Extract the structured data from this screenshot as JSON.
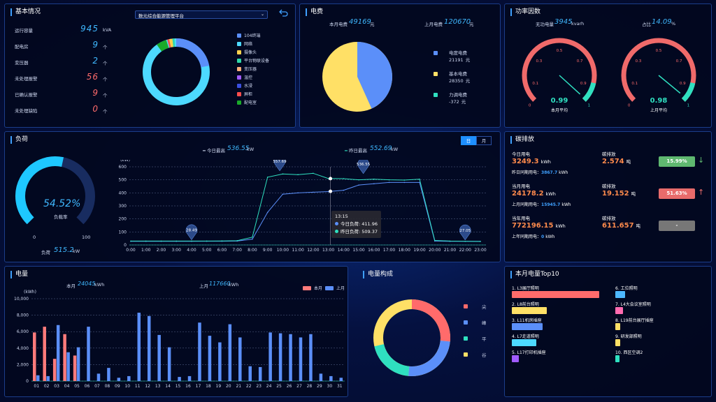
{
  "basic": {
    "title": "基本情况",
    "selector": "数元综合能源管理平台",
    "rows": [
      {
        "label": "运行容量",
        "value": "945",
        "unit": "kVA",
        "color": "#3fb8ff"
      },
      {
        "label": "配电房",
        "value": "9",
        "unit": "个",
        "color": "#3fb8ff"
      },
      {
        "label": "变压器",
        "value": "2",
        "unit": "个",
        "color": "#3fb8ff"
      },
      {
        "label": "未处理报警",
        "value": "56",
        "unit": "个",
        "color": "#ff6b6b"
      },
      {
        "label": "已确认报警",
        "value": "9",
        "unit": "个",
        "color": "#ff6b6b"
      },
      {
        "label": "未处理缺陷",
        "value": "0",
        "unit": "个",
        "color": "#ff6b6b"
      }
    ],
    "legend": [
      {
        "name": "104终端",
        "color": "#5b8ff9"
      },
      {
        "name": "网络",
        "color": "#4dd9ff"
      },
      {
        "name": "摄像头",
        "color": "#ffd24d"
      },
      {
        "name": "平台物联设备",
        "color": "#2fd8a8"
      },
      {
        "name": "变压器",
        "color": "#ffb07a"
      },
      {
        "name": "温控",
        "color": "#a05bff"
      },
      {
        "name": "水浸",
        "color": "#3a50e0"
      },
      {
        "name": "屏柜",
        "color": "#ff4d4d"
      },
      {
        "name": "配电室",
        "color": "#1aaa2a"
      }
    ]
  },
  "fee": {
    "title": "电费",
    "this_label": "本月电费",
    "this_value": "49169",
    "this_unit": "元",
    "last_label": "上月电费",
    "last_value": "120670",
    "last_unit": "元",
    "items": [
      {
        "name": "电度电费",
        "value": "21191",
        "unit": "元",
        "color": "#5b8ff9"
      },
      {
        "name": "基本电费",
        "value": "28350",
        "unit": "元",
        "color": "#ffe066"
      },
      {
        "name": "力调电费",
        "value": "-372",
        "unit": "元",
        "color": "#2fe0c0"
      }
    ]
  },
  "pf": {
    "title": "功率因数",
    "reactive_label": "无功电量",
    "reactive_value": "3945",
    "reactive_unit": "kvarh",
    "ratio_label": "占比",
    "ratio_value": "14.09",
    "ratio_unit": "%",
    "gauges": [
      {
        "value": "0.99",
        "label": "本月平均",
        "level": 0.99
      },
      {
        "value": "0.98",
        "label": "上月平均",
        "level": 0.98
      }
    ],
    "ticks": [
      "0",
      "0.1",
      "0.3",
      "0.5",
      "0.7",
      "0.9",
      "1"
    ]
  },
  "load": {
    "title": "负荷",
    "tabs": [
      "日",
      "月"
    ],
    "today_label": "今日最高",
    "today_value": "536.55",
    "today_unit": "kW",
    "yest_label": "昨日最高",
    "yest_value": "552.69",
    "yest_unit": "kW",
    "gauge_value": "54.52%",
    "gauge_label": "负载率",
    "gauge_min": "0",
    "gauge_max": "100",
    "gauge_level": 0.5452,
    "bottom_label": "负荷",
    "bottom_value": "515.2",
    "bottom_unit": "kW",
    "tip_time": "13:15",
    "tip_today": "今日负荷: 411.96",
    "tip_yest": "昨日负荷: 509.37",
    "pins": [
      {
        "label": "28.49"
      },
      {
        "label": "557.69"
      },
      {
        "label": "536.55"
      },
      {
        "label": "27.05"
      }
    ]
  },
  "carbon": {
    "title": "碳排放",
    "rows": [
      {
        "l1": "今日用电",
        "v1": "3249.3",
        "u1": "kWh",
        "sub_label": "昨日同期用电：",
        "sub_value": "3867.7",
        "sub_unit": "kWh",
        "l2": "碳排放",
        "v2": "2.574",
        "u2": "吨",
        "badge": "15.99%",
        "badge_color": "#5fb870",
        "arrow": "↓",
        "arrow_color": "#5fb870"
      },
      {
        "l1": "当月用电",
        "v1": "24178.2",
        "u1": "kWh",
        "sub_label": "上月同期用电：",
        "sub_value": "15945.7",
        "sub_unit": "kWh",
        "l2": "碳排放",
        "v2": "19.152",
        "u2": "吨",
        "badge": "51.63%",
        "badge_color": "#e86b6b",
        "arrow": "↑",
        "arrow_color": "#e86b6b"
      },
      {
        "l1": "当年用电",
        "v1": "772196.15",
        "u1": "kWh",
        "sub_label": "上年同期用电：",
        "sub_value": "0",
        "sub_unit": "kWh",
        "l2": "碳排放",
        "v2": "611.657",
        "u2": "吨",
        "badge": "-",
        "badge_color": "#777",
        "arrow": "",
        "arrow_color": "#777"
      }
    ]
  },
  "energy": {
    "title": "电量",
    "this_label": "本月",
    "this_value": "24045",
    "this_unit": "kWh",
    "last_label": "上月",
    "last_value": "117660",
    "last_unit": "kWh",
    "legend_this": "本月",
    "legend_last": "上月"
  },
  "comp": {
    "title": "电量构成",
    "items": [
      {
        "name": "尖",
        "color": "#ff6b6b"
      },
      {
        "name": "峰",
        "color": "#5b8ff9"
      },
      {
        "name": "平",
        "color": "#2fe0c0"
      },
      {
        "name": "谷",
        "color": "#ffe066"
      }
    ]
  },
  "top10": {
    "title": "本月电量Top10",
    "left": [
      {
        "name": "1. L3展厅照明",
        "color": "#ff6b6b",
        "level": 1.0
      },
      {
        "name": "2. L8前台照明",
        "color": "#ffe066",
        "level": 0.4
      },
      {
        "name": "3. L11机房插座",
        "color": "#5b8ff9",
        "level": 0.35
      },
      {
        "name": "4. L7走道照明",
        "color": "#4dd9ff",
        "level": 0.28
      },
      {
        "name": "5. L17打印机插座",
        "color": "#a05bff",
        "level": 0.08
      }
    ],
    "right": [
      {
        "name": "6. 工位照明",
        "color": "#4db8ff",
        "level": 0.12
      },
      {
        "name": "7. L4大会议室照明",
        "color": "#ff6bb0",
        "level": 0.09
      },
      {
        "name": "8. L19前台展厅插座",
        "color": "#ffe066",
        "level": 0.06
      },
      {
        "name": "9. 研发部照明",
        "color": "#ffe066",
        "level": 0.06
      },
      {
        "name": "10. 西区空调2",
        "color": "#2fe0c0",
        "level": 0.05
      }
    ]
  },
  "chart_data": [
    {
      "type": "line",
      "title": "负荷",
      "ylabel": "(kW)",
      "ylim": [
        0,
        600
      ],
      "yticks": [
        "0",
        "100",
        "200",
        "300",
        "400",
        "500",
        "600"
      ],
      "x": [
        "0:00",
        "1:00",
        "2:00",
        "3:00",
        "4:00",
        "5:00",
        "6:00",
        "7:00",
        "8:00",
        "9:00",
        "10:00",
        "11:00",
        "12:00",
        "13:00",
        "14:00",
        "15:00",
        "16:00",
        "17:00",
        "18:00",
        "19:00",
        "20:00",
        "21:00",
        "22:00",
        "23:00"
      ],
      "series": [
        {
          "name": "今日负荷",
          "values": [
            28,
            28,
            28,
            28,
            28,
            29,
            29,
            30,
            45,
            250,
            390,
            400,
            405,
            410,
            420,
            460,
            470,
            480,
            480,
            480,
            30,
            28,
            28,
            28
          ]
        },
        {
          "name": "昨日负荷",
          "values": [
            30,
            30,
            30,
            30,
            30,
            30,
            31,
            33,
            60,
            520,
            545,
            540,
            550,
            510,
            509,
            500,
            505,
            500,
            498,
            505,
            35,
            30,
            28,
            27
          ]
        }
      ]
    },
    {
      "type": "bar",
      "title": "电量",
      "ylabel": "(kWh)",
      "ylim": [
        0,
        10000
      ],
      "yticks": [
        "0",
        "2,000",
        "4,000",
        "6,000",
        "8,000",
        "10,000"
      ],
      "categories": [
        "01",
        "02",
        "03",
        "04",
        "05",
        "06",
        "07",
        "08",
        "09",
        "10",
        "11",
        "12",
        "13",
        "14",
        "15",
        "16",
        "17",
        "18",
        "19",
        "20",
        "21",
        "22",
        "23",
        "24",
        "25",
        "26",
        "27",
        "28",
        "29",
        "30",
        "31"
      ],
      "series": [
        {
          "name": "本月",
          "values": [
            5900,
            6600,
            2700,
            5700,
            3100,
            0,
            0,
            0,
            0,
            0,
            0,
            0,
            0,
            0,
            0,
            0,
            0,
            0,
            0,
            0,
            0,
            0,
            0,
            0,
            0,
            0,
            0,
            0,
            0,
            0,
            0
          ]
        },
        {
          "name": "上月",
          "values": [
            700,
            600,
            6800,
            3500,
            4100,
            6600,
            900,
            1600,
            400,
            600,
            8300,
            7900,
            5600,
            4100,
            500,
            600,
            7100,
            5500,
            4700,
            6900,
            5300,
            1800,
            1700,
            5900,
            5800,
            5700,
            5300,
            5700,
            900,
            600,
            400
          ]
        }
      ]
    }
  ]
}
